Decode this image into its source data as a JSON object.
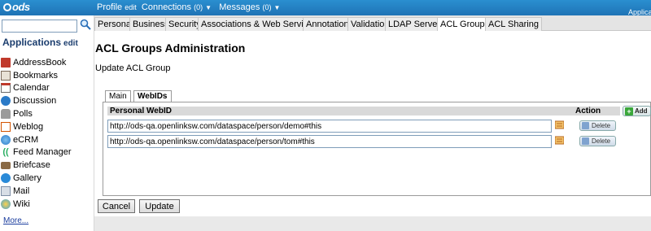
{
  "topbar": {
    "logo": "ods",
    "nav": [
      {
        "label": "Profile",
        "suffix": "edit",
        "caret": false
      },
      {
        "label": "Connections",
        "suffix": "(0)",
        "caret": true
      },
      {
        "label": "Messages",
        "suffix": "(0)",
        "caret": true
      }
    ],
    "right_text": "Applicat"
  },
  "sidebar": {
    "search": {
      "value": "",
      "placeholder": ""
    },
    "title": "Applications",
    "title_edit": "edit",
    "apps": [
      {
        "label": "AddressBook",
        "icon": "addressbook-icon",
        "color": "#c0392b"
      },
      {
        "label": "Bookmarks",
        "icon": "bookmarks-icon",
        "color": "#7a6a5a"
      },
      {
        "label": "Calendar",
        "icon": "calendar-icon",
        "color": "#6a6a6a"
      },
      {
        "label": "Discussion",
        "icon": "discussion-icon",
        "color": "#2a7ac8"
      },
      {
        "label": "Polls",
        "icon": "polls-icon",
        "color": "#888888"
      },
      {
        "label": "Weblog",
        "icon": "weblog-icon",
        "color": "#d35400"
      },
      {
        "label": "eCRM",
        "icon": "ecrm-icon",
        "color": "#2a7ac8"
      },
      {
        "label": "Feed Manager",
        "icon": "feed-icon",
        "color": "#27ae60"
      },
      {
        "label": "Briefcase",
        "icon": "briefcase-icon",
        "color": "#7a5a3a"
      },
      {
        "label": "Gallery",
        "icon": "gallery-icon",
        "color": "#2a8ad8"
      },
      {
        "label": "Mail",
        "icon": "mail-icon",
        "color": "#7f8fa6"
      },
      {
        "label": "Wiki",
        "icon": "wiki-icon",
        "color": "#3aa0d8"
      }
    ],
    "more": "More..."
  },
  "tabs": [
    {
      "label": "Personal",
      "active": false
    },
    {
      "label": "Business",
      "active": false
    },
    {
      "label": "Security",
      "active": false
    },
    {
      "label": "Associations & Web Services",
      "active": false
    },
    {
      "label": "Annotations",
      "active": false
    },
    {
      "label": "Validation",
      "active": false
    },
    {
      "label": "LDAP Servers",
      "active": false
    },
    {
      "label": "ACL Groups",
      "active": true
    },
    {
      "label": "ACL Sharing",
      "active": false
    }
  ],
  "main": {
    "title": "ACL Groups Administration",
    "subtitle": "Update ACL Group",
    "inner_tabs": [
      {
        "label": "Main",
        "active": false
      },
      {
        "label": "WebIDs",
        "active": true
      }
    ],
    "table": {
      "col_webid": "Personal WebID",
      "col_action": "Action",
      "add_label": "Add",
      "delete_label": "Delete",
      "rows": [
        "http://ods-qa.openlinksw.com/dataspace/person/demo#this",
        "http://ods-qa.openlinksw.com/dataspace/person/tom#this"
      ]
    },
    "cancel_label": "Cancel",
    "update_label": "Update"
  },
  "colors": {
    "topbar": "#1f73b5",
    "accent_text": "#1b3d6e",
    "link": "#1b3d9e",
    "add_green": "#3aa73a"
  }
}
